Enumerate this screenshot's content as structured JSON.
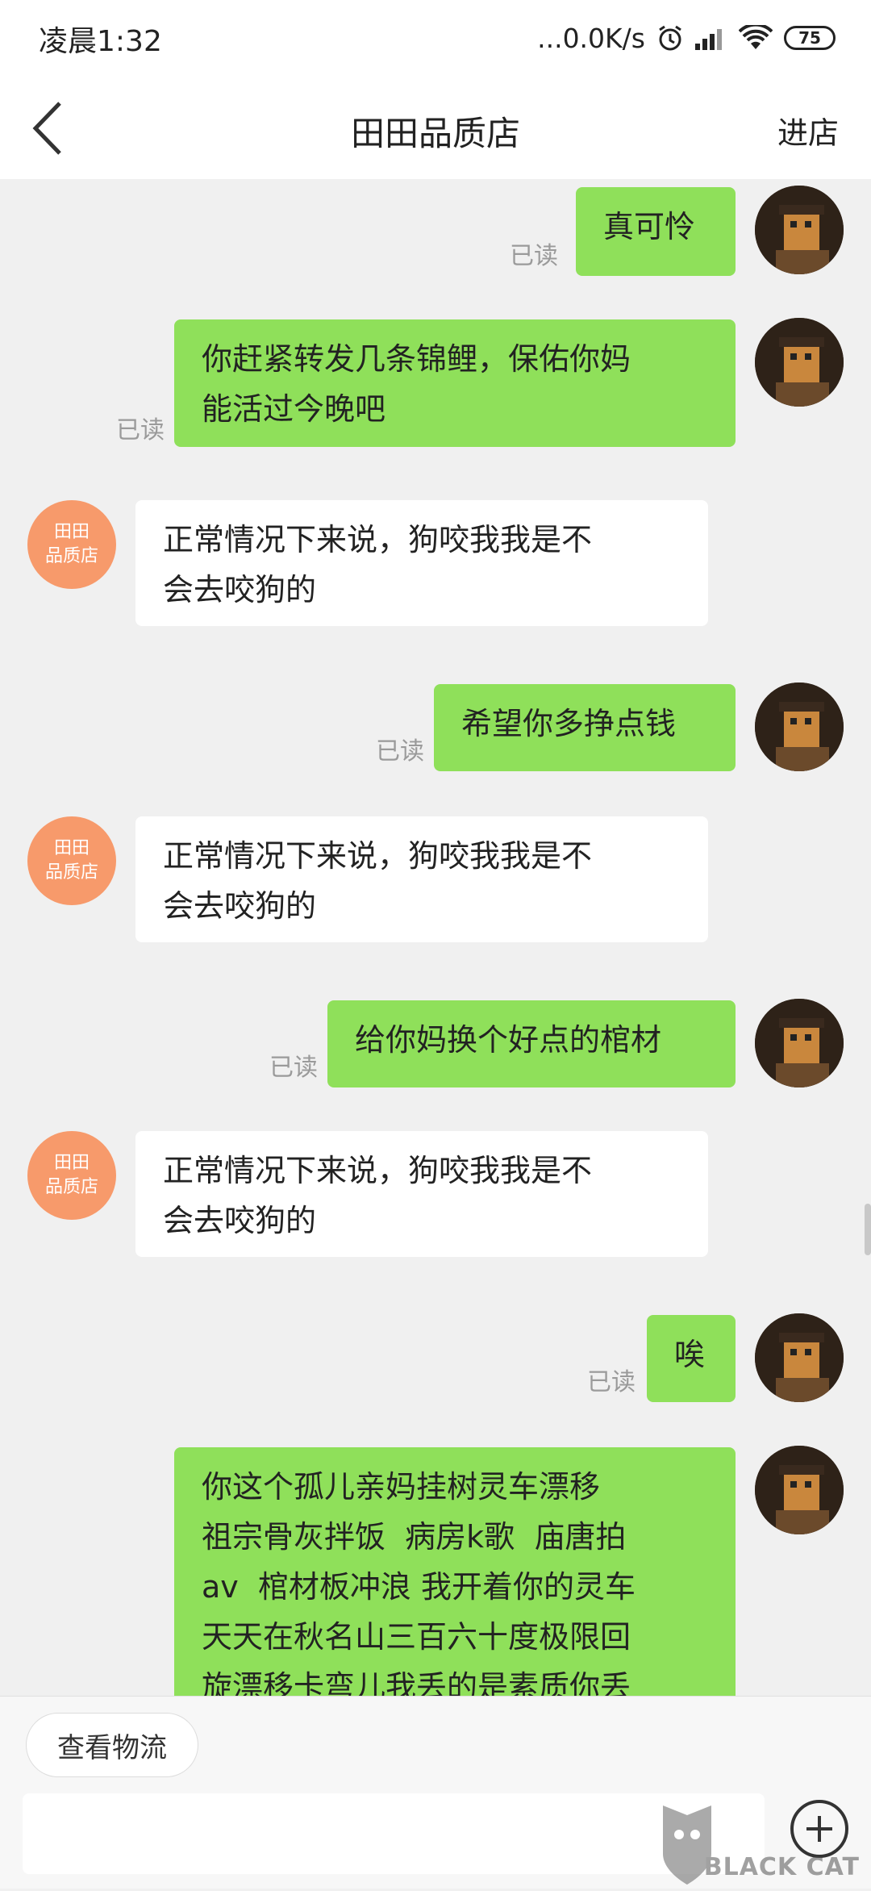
{
  "status_bar": {
    "time": "凌晨1:32",
    "network_speed": "...0.0K/s",
    "battery": "75",
    "icons": [
      "alarm-icon",
      "signal-icon",
      "wifi-icon",
      "battery-icon"
    ]
  },
  "header": {
    "title": "田田品质店",
    "enter_store": "进店"
  },
  "shop_avatar_text": "田田\n品质店",
  "read_label": "已读",
  "messages": [
    {
      "from": "me",
      "text": "真可怜",
      "read": "已读"
    },
    {
      "from": "me",
      "text": "你赶紧转发几条锦鲤，保佑你妈\n能活过今晚吧",
      "read": "已读"
    },
    {
      "from": "shop",
      "text": "正常情况下来说，狗咬我我是不\n会去咬狗的"
    },
    {
      "from": "me",
      "text": "希望你多挣点钱",
      "read": "已读"
    },
    {
      "from": "shop",
      "text": "正常情况下来说，狗咬我我是不\n会去咬狗的"
    },
    {
      "from": "me",
      "text": "给你妈换个好点的棺材",
      "read": "已读"
    },
    {
      "from": "shop",
      "text": "正常情况下来说，狗咬我我是不\n会去咬狗的"
    },
    {
      "from": "me",
      "text": "唉",
      "read": "已读"
    },
    {
      "from": "me",
      "text": "你这个孤儿亲妈挂树灵车漂移\n祖宗骨灰拌饭  病房k歌  庙唐拍\nav  棺材板冲浪 我开着你的灵车\n天天在秋名山三百六十度极限回\n旋漂移卡弯儿我丢的是素质你丢"
    }
  ],
  "bottom": {
    "logistics_button": "查看物流"
  },
  "watermark": {
    "brand": "BLACK CAT"
  },
  "colors": {
    "outgoing_bubble": "#8fe05a",
    "incoming_bubble": "#ffffff",
    "shop_avatar": "#f79a6b",
    "background": "#f0f0f0"
  }
}
